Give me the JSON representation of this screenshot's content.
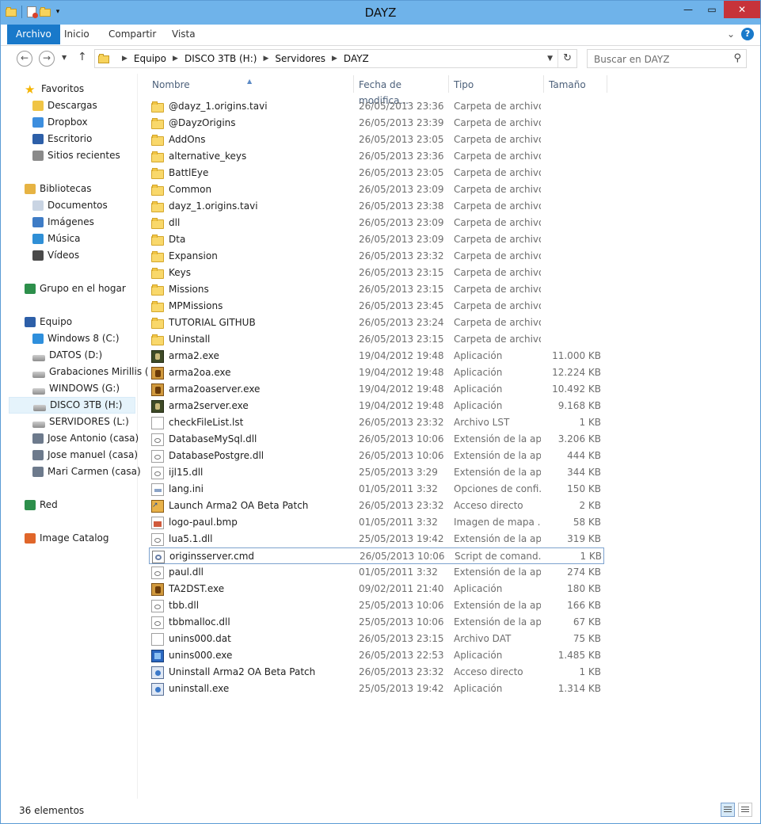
{
  "window": {
    "title": "DAYZ"
  },
  "ribbon": {
    "tabs": [
      "Archivo",
      "Inicio",
      "Compartir",
      "Vista"
    ],
    "help": "?"
  },
  "address": {
    "crumbs": [
      "Equipo",
      "DISCO 3TB (H:)",
      "Servidores",
      "DAYZ"
    ]
  },
  "search": {
    "placeholder": "Buscar en DAYZ"
  },
  "nav": [
    {
      "label": "Favoritos",
      "icon": "star-icon",
      "group": true
    },
    {
      "label": "Descargas",
      "icon": "downloads-icon"
    },
    {
      "label": "Dropbox",
      "icon": "dropbox-icon"
    },
    {
      "label": "Escritorio",
      "icon": "desktop-icon"
    },
    {
      "label": "Sitios recientes",
      "icon": "recent-places-icon"
    },
    {
      "label": "Bibliotecas",
      "icon": "libraries-icon",
      "group": true
    },
    {
      "label": "Documentos",
      "icon": "documents-icon"
    },
    {
      "label": "Imágenes",
      "icon": "pictures-icon"
    },
    {
      "label": "Música",
      "icon": "music-icon"
    },
    {
      "label": "Vídeos",
      "icon": "videos-icon"
    },
    {
      "label": "Grupo en el hogar",
      "icon": "homegroup-icon",
      "group": true
    },
    {
      "label": "Equipo",
      "icon": "computer-icon",
      "group": true
    },
    {
      "label": "Windows 8 (C:)",
      "icon": "windows-drive-icon"
    },
    {
      "label": "DATOS (D:)",
      "icon": "drive-icon"
    },
    {
      "label": "Grabaciones Mirillis (",
      "icon": "drive-icon"
    },
    {
      "label": "WINDOWS (G:)",
      "icon": "drive-icon"
    },
    {
      "label": "DISCO 3TB (H:)",
      "icon": "drive-icon",
      "selected": true
    },
    {
      "label": "SERVIDORES (L:)",
      "icon": "drive-icon"
    },
    {
      "label": "Jose Antonio (casa)",
      "icon": "network-drive-icon"
    },
    {
      "label": "Jose manuel (casa)",
      "icon": "network-drive-icon"
    },
    {
      "label": "Mari Carmen (casa)",
      "icon": "network-drive-icon"
    },
    {
      "label": "Red",
      "icon": "network-icon",
      "group": true
    },
    {
      "label": "Image Catalog",
      "icon": "image-catalog-icon",
      "group": true
    }
  ],
  "columns": {
    "name": "Nombre",
    "date": "Fecha de modifica...",
    "type": "Tipo",
    "size": "Tamaño"
  },
  "files": [
    {
      "name": "@dayz_1.origins.tavi",
      "date": "26/05/2013 23:36",
      "type": "Carpeta de archivos",
      "size": "",
      "icon": "folder"
    },
    {
      "name": "@DayzOrigins",
      "date": "26/05/2013 23:39",
      "type": "Carpeta de archivos",
      "size": "",
      "icon": "folder"
    },
    {
      "name": "AddOns",
      "date": "26/05/2013 23:05",
      "type": "Carpeta de archivos",
      "size": "",
      "icon": "folder"
    },
    {
      "name": "alternative_keys",
      "date": "26/05/2013 23:36",
      "type": "Carpeta de archivos",
      "size": "",
      "icon": "folder"
    },
    {
      "name": "BattlEye",
      "date": "26/05/2013 23:05",
      "type": "Carpeta de archivos",
      "size": "",
      "icon": "folder"
    },
    {
      "name": "Common",
      "date": "26/05/2013 23:09",
      "type": "Carpeta de archivos",
      "size": "",
      "icon": "folder"
    },
    {
      "name": "dayz_1.origins.tavi",
      "date": "26/05/2013 23:38",
      "type": "Carpeta de archivos",
      "size": "",
      "icon": "folder"
    },
    {
      "name": "dll",
      "date": "26/05/2013 23:09",
      "type": "Carpeta de archivos",
      "size": "",
      "icon": "folder"
    },
    {
      "name": "Dta",
      "date": "26/05/2013 23:09",
      "type": "Carpeta de archivos",
      "size": "",
      "icon": "folder"
    },
    {
      "name": "Expansion",
      "date": "26/05/2013 23:32",
      "type": "Carpeta de archivos",
      "size": "",
      "icon": "folder"
    },
    {
      "name": "Keys",
      "date": "26/05/2013 23:15",
      "type": "Carpeta de archivos",
      "size": "",
      "icon": "folder"
    },
    {
      "name": "Missions",
      "date": "26/05/2013 23:15",
      "type": "Carpeta de archivos",
      "size": "",
      "icon": "folder"
    },
    {
      "name": "MPMissions",
      "date": "26/05/2013 23:45",
      "type": "Carpeta de archivos",
      "size": "",
      "icon": "folder"
    },
    {
      "name": "TUTORIAL GITHUB",
      "date": "26/05/2013 23:24",
      "type": "Carpeta de archivos",
      "size": "",
      "icon": "folder"
    },
    {
      "name": "Uninstall",
      "date": "26/05/2013 23:15",
      "type": "Carpeta de archivos",
      "size": "",
      "icon": "folder"
    },
    {
      "name": "arma2.exe",
      "date": "19/04/2012 19:48",
      "type": "Aplicación",
      "size": "11.000 KB",
      "icon": "exe-arma"
    },
    {
      "name": "arma2oa.exe",
      "date": "19/04/2012 19:48",
      "type": "Aplicación",
      "size": "12.224 KB",
      "icon": "exe-gold"
    },
    {
      "name": "arma2oaserver.exe",
      "date": "19/04/2012 19:48",
      "type": "Aplicación",
      "size": "10.492 KB",
      "icon": "exe-gold"
    },
    {
      "name": "arma2server.exe",
      "date": "19/04/2012 19:48",
      "type": "Aplicación",
      "size": "9.168 KB",
      "icon": "exe-arma"
    },
    {
      "name": "checkFileList.lst",
      "date": "26/05/2013 23:32",
      "type": "Archivo LST",
      "size": "1 KB",
      "icon": "doc"
    },
    {
      "name": "DatabaseMySql.dll",
      "date": "26/05/2013 10:06",
      "type": "Extensión de la apl...",
      "size": "3.206 KB",
      "icon": "dll"
    },
    {
      "name": "DatabasePostgre.dll",
      "date": "26/05/2013 10:06",
      "type": "Extensión de la apl...",
      "size": "444 KB",
      "icon": "dll"
    },
    {
      "name": "ijl15.dll",
      "date": "25/05/2013 3:29",
      "type": "Extensión de la apl...",
      "size": "344 KB",
      "icon": "dll"
    },
    {
      "name": "lang.ini",
      "date": "01/05/2011 3:32",
      "type": "Opciones de confi...",
      "size": "150 KB",
      "icon": "ini"
    },
    {
      "name": "Launch Arma2 OA Beta Patch",
      "date": "26/05/2013 23:32",
      "type": "Acceso directo",
      "size": "2 KB",
      "icon": "lnk"
    },
    {
      "name": "logo-paul.bmp",
      "date": "01/05/2011 3:32",
      "type": "Imagen de mapa ...",
      "size": "58 KB",
      "icon": "bmp"
    },
    {
      "name": "lua5.1.dll",
      "date": "25/05/2013 19:42",
      "type": "Extensión de la apl...",
      "size": "319 KB",
      "icon": "dll"
    },
    {
      "name": "originsserver.cmd",
      "date": "26/05/2013 10:06",
      "type": "Script de comand...",
      "size": "1 KB",
      "icon": "cmd",
      "focused": true
    },
    {
      "name": "paul.dll",
      "date": "01/05/2011 3:32",
      "type": "Extensión de la apl...",
      "size": "274 KB",
      "icon": "dll"
    },
    {
      "name": "TA2DST.exe",
      "date": "09/02/2011 21:40",
      "type": "Aplicación",
      "size": "180 KB",
      "icon": "exe-gold"
    },
    {
      "name": "tbb.dll",
      "date": "25/05/2013 10:06",
      "type": "Extensión de la apl...",
      "size": "166 KB",
      "icon": "dll"
    },
    {
      "name": "tbbmalloc.dll",
      "date": "25/05/2013 10:06",
      "type": "Extensión de la apl...",
      "size": "67 KB",
      "icon": "dll"
    },
    {
      "name": "unins000.dat",
      "date": "26/05/2013 23:15",
      "type": "Archivo DAT",
      "size": "75 KB",
      "icon": "doc"
    },
    {
      "name": "unins000.exe",
      "date": "26/05/2013 22:53",
      "type": "Aplicación",
      "size": "1.485 KB",
      "icon": "inst"
    },
    {
      "name": "Uninstall Arma2 OA Beta Patch",
      "date": "26/05/2013 23:32",
      "type": "Acceso directo",
      "size": "1 KB",
      "icon": "uninst"
    },
    {
      "name": "uninstall.exe",
      "date": "25/05/2013 19:42",
      "type": "Aplicación",
      "size": "1.314 KB",
      "icon": "uninst"
    }
  ],
  "status": {
    "count": "36 elementos"
  }
}
